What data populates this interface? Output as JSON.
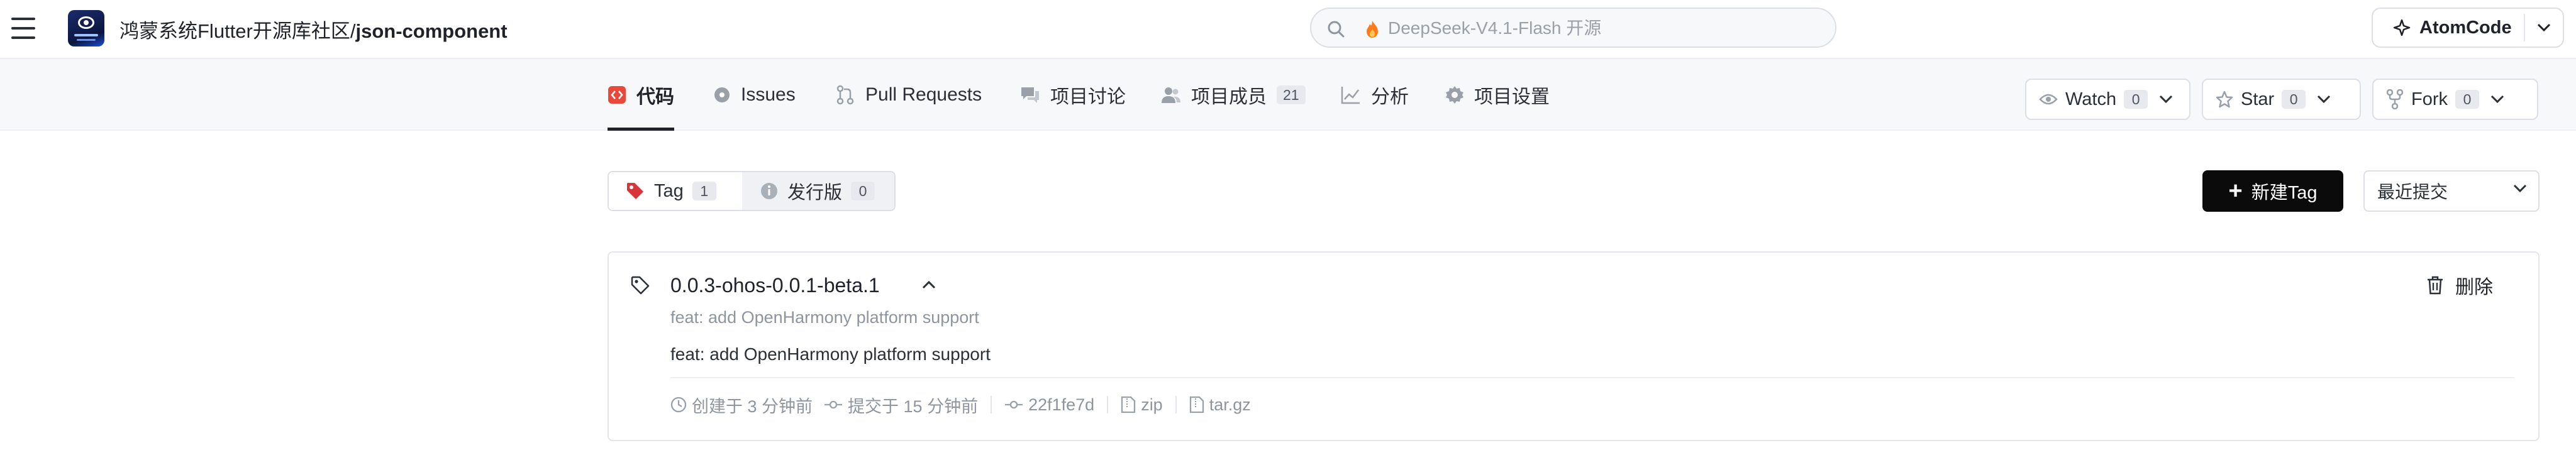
{
  "header": {
    "repo_org": "鸿蒙系统Flutter开源库社区/",
    "repo_name": "json-component",
    "search_placeholder": "DeepSeek-V4.1-Flash 开源",
    "atom_label": "AtomCode"
  },
  "tabs": [
    {
      "label": "代码",
      "active": true
    },
    {
      "label": "Issues"
    },
    {
      "label": "Pull Requests"
    },
    {
      "label": "项目讨论"
    },
    {
      "label": "项目成员",
      "count": "21"
    },
    {
      "label": "分析"
    },
    {
      "label": "项目设置"
    }
  ],
  "repo_actions": {
    "watch": {
      "label": "Watch",
      "count": "0"
    },
    "star": {
      "label": "Star",
      "count": "0"
    },
    "fork": {
      "label": "Fork",
      "count": "0"
    }
  },
  "filter": {
    "tag": {
      "label": "Tag",
      "count": "1"
    },
    "release": {
      "label": "发行版",
      "count": "0"
    },
    "new_tag": "新建Tag",
    "sort": "最近提交"
  },
  "tag_item": {
    "name": "0.0.3-ohos-0.0.1-beta.1",
    "message_summary": "feat: add OpenHarmony platform support",
    "message": "feat: add OpenHarmony platform support",
    "created": "创建于 3 分钟前",
    "committed": "提交于 15 分钟前",
    "commit": "22f1fe7d",
    "zip": "zip",
    "targz": "tar.gz",
    "delete": "删除"
  },
  "colors": {
    "accent": "#1f2329",
    "code_icon_red": "#e8493b",
    "tag_icon_red": "#d9343a",
    "primary_button": "#0b0b0c"
  }
}
